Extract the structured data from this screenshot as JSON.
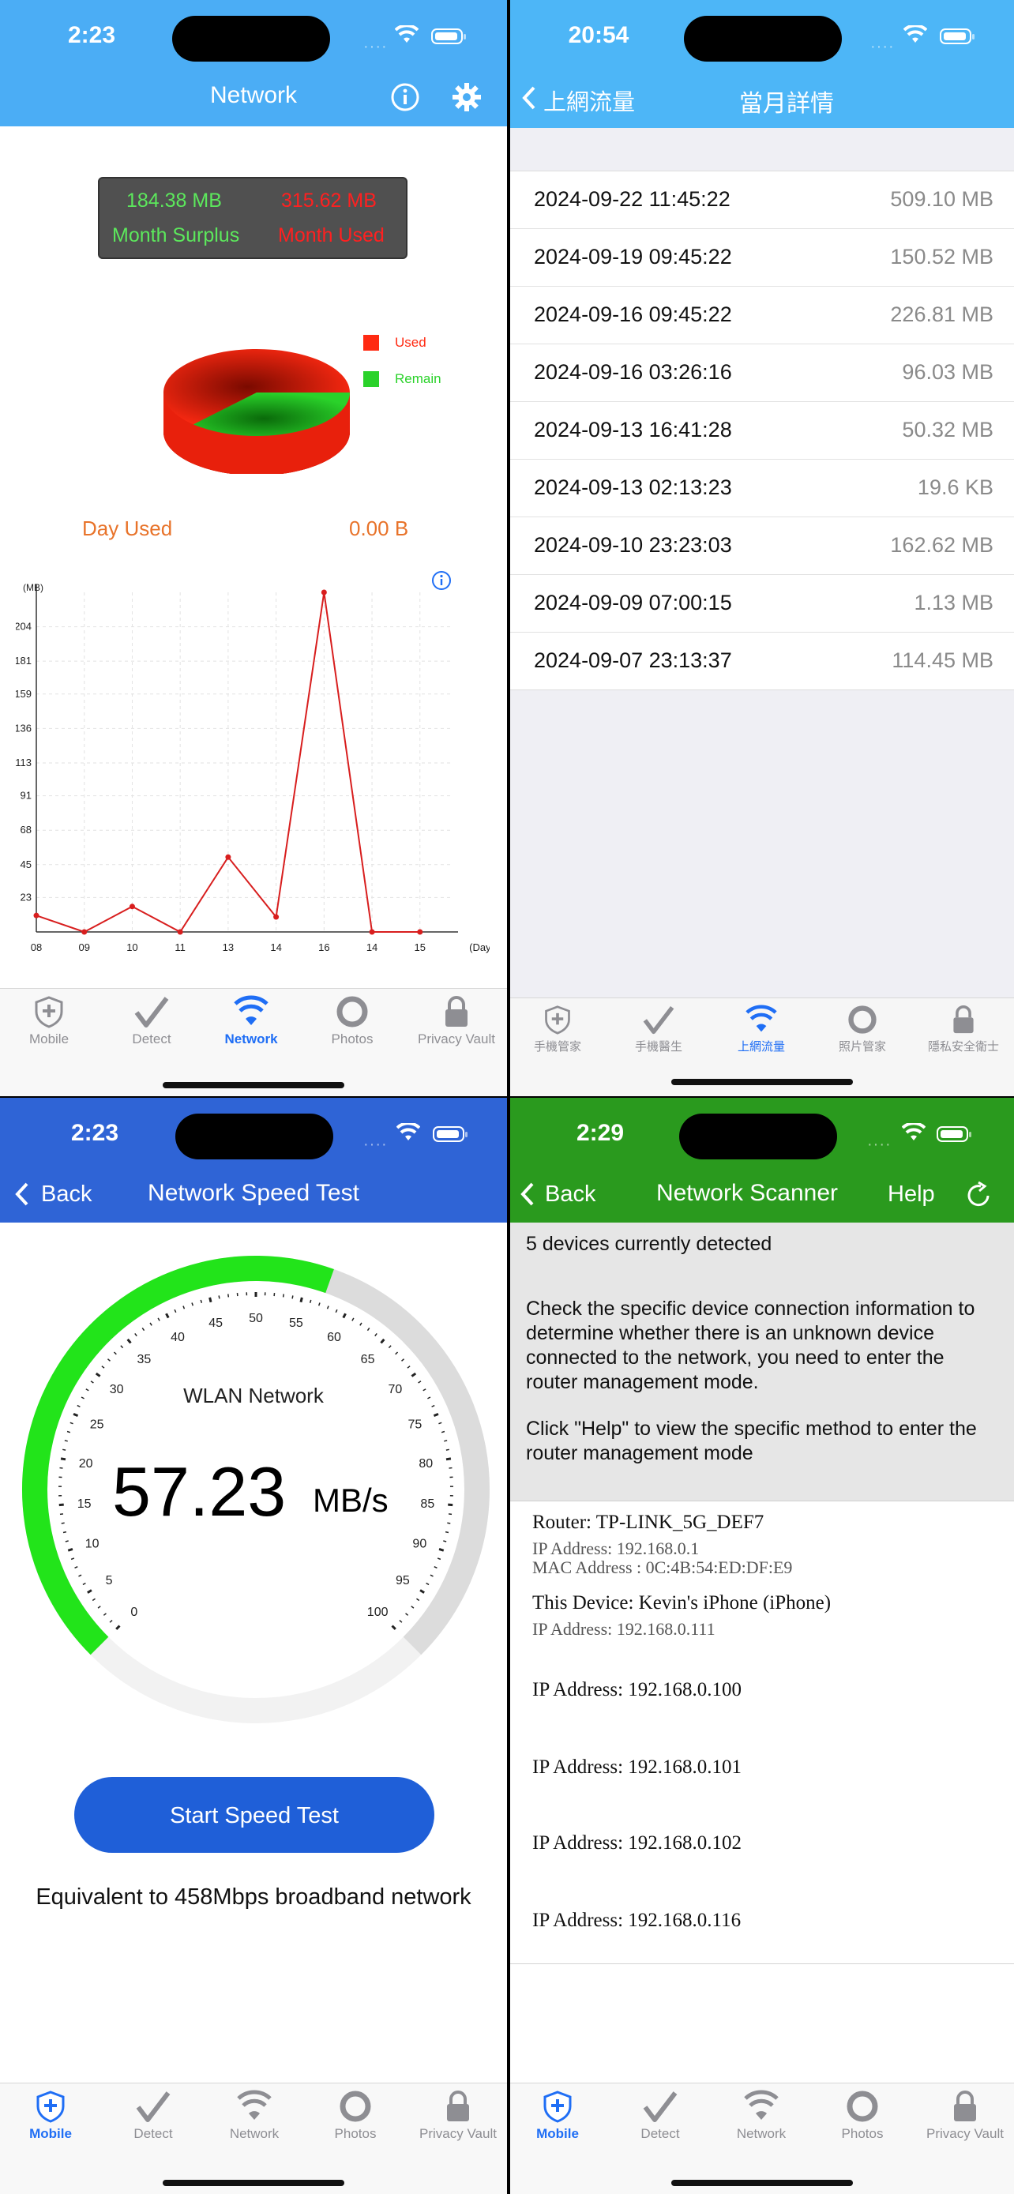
{
  "screens": {
    "network": {
      "time": "2:23",
      "title": "Network",
      "month_surplus_value": "184.38 MB",
      "month_used_value": "315.62 MB",
      "month_surplus_label": "Month Surplus",
      "month_used_label": "Month Used",
      "legend_used": "Used",
      "legend_remain": "Remain",
      "day_used_label": "Day Used",
      "day_used_value": "0.00 B",
      "colors": {
        "header": "#4badf5",
        "used": "#ff2a12",
        "remain": "#2ad22a",
        "line": "#d81e1e",
        "orange": "#e8732a"
      },
      "pie_data": {
        "type": "pie",
        "slices": [
          {
            "name": "Used",
            "value": 315.62
          },
          {
            "name": "Remain",
            "value": 184.38
          }
        ]
      },
      "chart_data": {
        "type": "line",
        "ylabel": "(MB)",
        "xlabel": "(Day)",
        "x": [
          "08",
          "09",
          "10",
          "11",
          "13",
          "14",
          "16",
          "14",
          "15"
        ],
        "values": [
          11,
          0,
          17,
          0,
          50,
          10,
          227,
          0,
          0
        ],
        "yticks": [
          "23",
          "45",
          "68",
          "91",
          "113",
          "136",
          "159",
          "181",
          "204"
        ],
        "ylim": [
          0,
          227
        ],
        "grid": true
      },
      "tabs": [
        {
          "label": "Mobile",
          "icon": "shield-plus-icon"
        },
        {
          "label": "Detect",
          "icon": "checkmark-icon"
        },
        {
          "label": "Network",
          "icon": "wifi-icon"
        },
        {
          "label": "Photos",
          "icon": "ring-icon"
        },
        {
          "label": "Privacy Vault",
          "icon": "lock-icon"
        }
      ]
    },
    "monthly": {
      "time": "20:54",
      "back_label": "上網流量",
      "title": "當月詳情",
      "rows": [
        {
          "date": "2024-09-22 11:45:22",
          "value": "509.10 MB"
        },
        {
          "date": "2024-09-19 09:45:22",
          "value": "150.52 MB"
        },
        {
          "date": "2024-09-16 09:45:22",
          "value": "226.81 MB"
        },
        {
          "date": "2024-09-16 03:26:16",
          "value": "96.03 MB"
        },
        {
          "date": "2024-09-13 16:41:28",
          "value": "50.32 MB"
        },
        {
          "date": "2024-09-13 02:13:23",
          "value": "19.6 KB"
        },
        {
          "date": "2024-09-10 23:23:03",
          "value": "162.62 MB"
        },
        {
          "date": "2024-09-09 07:00:15",
          "value": "1.13 MB"
        },
        {
          "date": "2024-09-07 23:13:37",
          "value": "114.45 MB"
        }
      ],
      "tabs": [
        {
          "label": "手機管家",
          "icon": "shield-plus-icon"
        },
        {
          "label": "手機醫生",
          "icon": "checkmark-icon"
        },
        {
          "label": "上網流量",
          "icon": "wifi-icon"
        },
        {
          "label": "照片管家",
          "icon": "ring-icon"
        },
        {
          "label": "隱私安全衛士",
          "icon": "lock-icon"
        }
      ]
    },
    "speed": {
      "time": "2:23",
      "back_label": "Back",
      "title": "Network Speed Test",
      "gauge_label": "WLAN Network",
      "speed_value": "57.23",
      "speed_unit": "MB/s",
      "gauge_max": 100,
      "gauge_ticks": [
        "0",
        "5",
        "10",
        "15",
        "20",
        "25",
        "30",
        "35",
        "40",
        "45",
        "50",
        "55",
        "60",
        "65",
        "70",
        "75",
        "80",
        "85",
        "90",
        "95",
        "100"
      ],
      "start_button": "Start Speed Test",
      "equivalent_text": "Equivalent to 458Mbps broadband network",
      "tabs": [
        {
          "label": "Mobile",
          "icon": "shield-plus-icon"
        },
        {
          "label": "Detect",
          "icon": "checkmark-icon"
        },
        {
          "label": "Network",
          "icon": "wifi-icon"
        },
        {
          "label": "Photos",
          "icon": "ring-icon"
        },
        {
          "label": "Privacy Vault",
          "icon": "lock-icon"
        }
      ]
    },
    "scanner": {
      "time": "2:29",
      "back_label": "Back",
      "title": "Network Scanner",
      "help_label": "Help",
      "devices_count_text": "5 devices currently detected",
      "instructions_1": "Check the specific device connection information to determine whether there is an unknown device connected to the network, you need to enter the router management mode.",
      "instructions_2": "Click \"Help\" to view the specific method to enter the router management mode",
      "router_name": "Router: TP-LINK_5G_DEF7",
      "router_ip": "IP Address: 192.168.0.1",
      "router_mac": "MAC Address : 0C:4B:54:ED:DF:E9",
      "this_device_name": "This Device: Kevin's iPhone (iPhone)",
      "this_device_ip": "IP Address: 192.168.0.111",
      "other_devices": [
        "IP Address: 192.168.0.100",
        "IP Address: 192.168.0.101",
        "IP Address: 192.168.0.102",
        "IP Address: 192.168.0.116"
      ],
      "tabs": [
        {
          "label": "Mobile",
          "icon": "shield-plus-icon"
        },
        {
          "label": "Detect",
          "icon": "checkmark-icon"
        },
        {
          "label": "Network",
          "icon": "wifi-icon"
        },
        {
          "label": "Photos",
          "icon": "ring-icon"
        },
        {
          "label": "Privacy Vault",
          "icon": "lock-icon"
        }
      ]
    }
  }
}
